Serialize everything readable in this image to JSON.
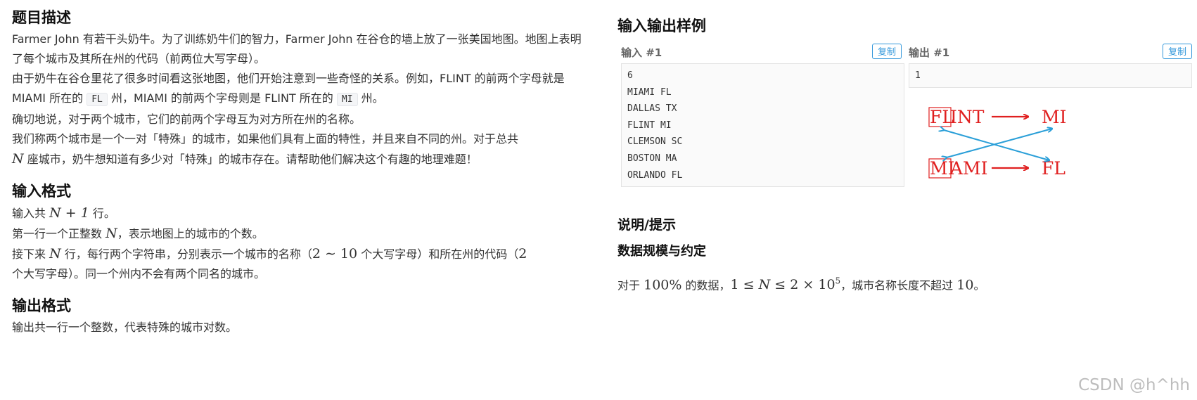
{
  "description": {
    "heading": "题目描述",
    "p1": "Farmer John 有若干头奶牛。为了训练奶牛们的智力，Farmer John 在谷仓的墙上放了一张美国地图。地图上表明了每个城市及其所在州的代码（前两位大写字母）。",
    "p2_a": "由于奶牛在谷仓里花了很多时间看这张地图，他们开始注意到一些奇怪的关系。例如，FLINT 的前两个字母就是 MIAMI 所在的",
    "p2_code1": "FL",
    "p2_b": "州，MIAMI 的前两个字母则是 FLINT 所在的",
    "p2_code2": "MI",
    "p2_c": "州。",
    "p3": "确切地说，对于两个城市，它们的前两个字母互为对方所在州的名称。",
    "p4_a": "我们称两个城市是一个一对「特殊」的城市，如果他们具有上面的特性，并且来自不同的州。对于总共",
    "p4_N": "N",
    "p4_b": "座城市，奶牛想知道有多少对「特殊」的城市存在。请帮助他们解决这个有趣的地理难题！"
  },
  "input_format": {
    "heading": "输入格式",
    "l1_a": "输入共",
    "l1_math": "N + 1",
    "l1_b": "行。",
    "l2_a": "第一行一个正整数",
    "l2_N": "N",
    "l2_b": "，表示地图上的城市的个数。",
    "l3_a": "接下来",
    "l3_N": "N",
    "l3_b": "行，每行两个字符串，分别表示一个城市的名称（",
    "l3_range": "2 ∼ 10",
    "l3_c": "个大写字母）和所在州的代码（",
    "l3_two": "2",
    "l3_d": "个大写字母）。同一个州内不会有两个同名的城市。"
  },
  "output_format": {
    "heading": "输出格式",
    "text": "输出共一行一个整数，代表特殊的城市对数。"
  },
  "samples": {
    "heading": "输入输出样例",
    "input_label": "输入 #1",
    "output_label": "输出 #1",
    "copy_label": "复制",
    "input_lines": [
      "6",
      "MIAMI FL",
      "DALLAS TX",
      "FLINT MI",
      "CLEMSON SC",
      "BOSTON MA",
      "ORLANDO FL"
    ],
    "output_lines": [
      "1"
    ]
  },
  "figure": {
    "flint_prefix": "FL",
    "flint_rest": "INT",
    "miami_prefix": "MI",
    "miami_rest": "AMI",
    "state_mi": "MI",
    "state_fl": "FL",
    "red": "#e02020",
    "blue": "#2a9fd8"
  },
  "hints": {
    "heading": "说明/提示",
    "subheading": "数据规模与约定",
    "t_a": "对于",
    "t_pct": "100%",
    "t_b": "的数据，",
    "t_c": "，城市名称长度不超过",
    "t_ten": "10",
    "t_d": "。"
  },
  "watermark": "CSDN @h^hh"
}
